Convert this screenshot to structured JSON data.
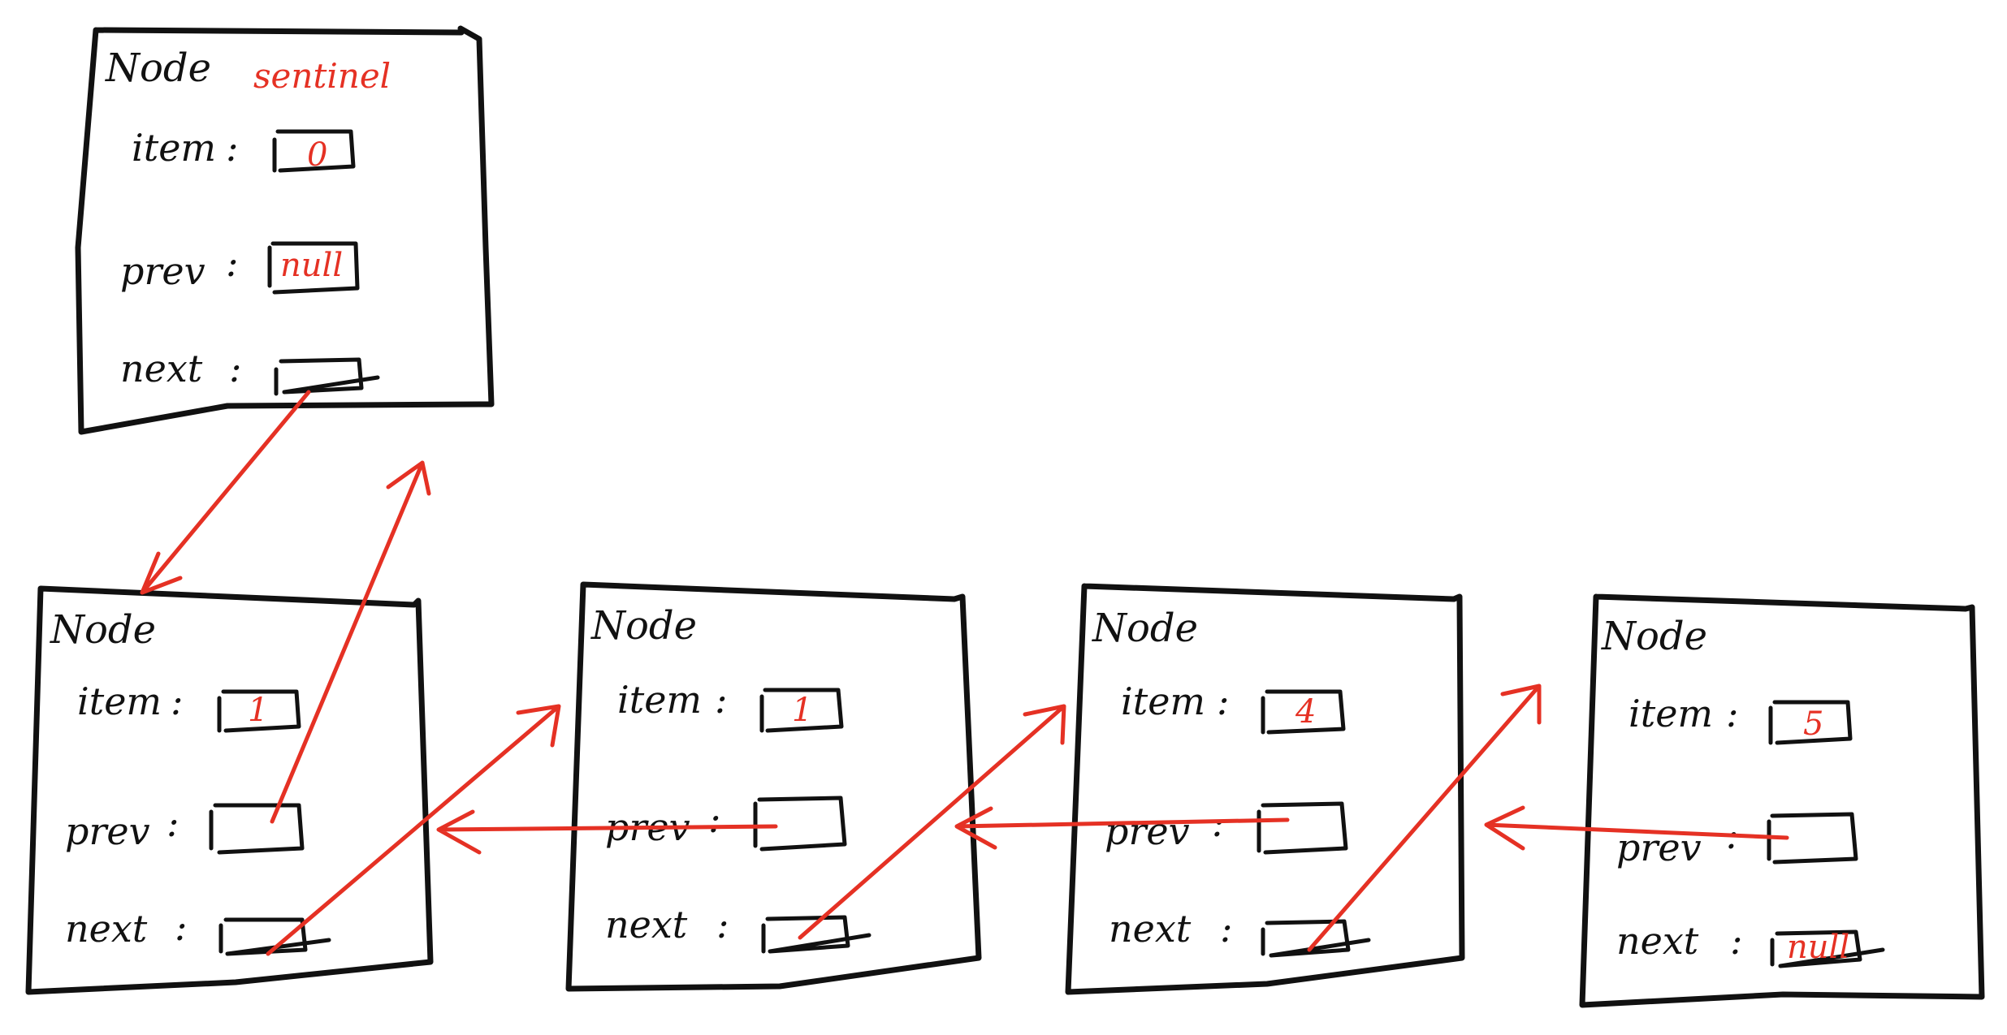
{
  "colors": {
    "ink": "#111111",
    "accent": "#e53124",
    "background": "#ffffff"
  },
  "nodes": [
    {
      "title": "Node",
      "tag": "sentinel",
      "item_label": "item",
      "item_value": "0",
      "prev_label": "prev",
      "prev_value": "null",
      "next_label": "next",
      "next_value": ""
    },
    {
      "title": "Node",
      "tag": "",
      "item_label": "item",
      "item_value": "1",
      "prev_label": "prev",
      "prev_value": "",
      "next_label": "next",
      "next_value": ""
    },
    {
      "title": "Node",
      "tag": "",
      "item_label": "item",
      "item_value": "1",
      "prev_label": "prev",
      "prev_value": "",
      "next_label": "next",
      "next_value": ""
    },
    {
      "title": "Node",
      "tag": "",
      "item_label": "item",
      "item_value": "4",
      "prev_label": "prev",
      "prev_value": "",
      "next_label": "next",
      "next_value": ""
    },
    {
      "title": "Node",
      "tag": "",
      "item_label": "item",
      "item_value": "5",
      "prev_label": "prev",
      "prev_value": "",
      "next_label": "next",
      "next_value": "null"
    }
  ],
  "separator": ":",
  "links": [
    {
      "from": "sentinel.next",
      "to": "node1",
      "kind": "next"
    },
    {
      "from": "node1.prev",
      "to": "sentinel",
      "kind": "prev"
    },
    {
      "from": "node1.next",
      "to": "node2",
      "kind": "next"
    },
    {
      "from": "node2.prev",
      "to": "node1",
      "kind": "prev"
    },
    {
      "from": "node2.next",
      "to": "node3",
      "kind": "next"
    },
    {
      "from": "node3.prev",
      "to": "node2",
      "kind": "prev"
    },
    {
      "from": "node3.next",
      "to": "node4",
      "kind": "next"
    },
    {
      "from": "node4.prev",
      "to": "node3",
      "kind": "prev"
    }
  ]
}
